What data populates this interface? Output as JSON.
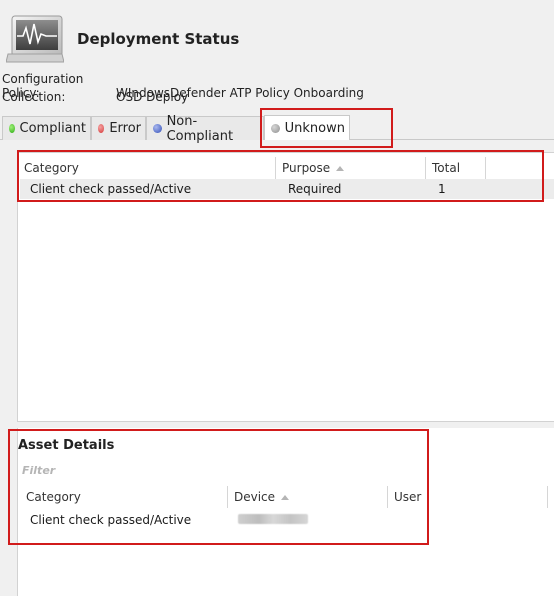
{
  "header": {
    "title": "Deployment Status",
    "icon": "monitor-pulse-icon"
  },
  "meta": {
    "policy_label": "Configuration Policy:",
    "policy_value": "WIndowsDefender ATP Policy Onboarding",
    "collection_label": "Collection:",
    "collection_value": "OSD Deploy"
  },
  "tabs": [
    {
      "label": "Compliant",
      "color": "#2fae14"
    },
    {
      "label": "Error",
      "color": "#d63a3a"
    },
    {
      "label": "Non-Compliant",
      "color": "#3450b8"
    },
    {
      "label": "Unknown",
      "color": "#8f8f8f",
      "active": true
    }
  ],
  "summary_grid": {
    "columns": [
      "Category",
      "Purpose",
      "Total"
    ],
    "rows": [
      {
        "category": "Client check passed/Active",
        "purpose": "Required",
        "total": "1"
      }
    ]
  },
  "asset_details": {
    "title": "Asset Details",
    "filter_placeholder": "Filter",
    "columns": [
      "Category",
      "Device",
      "User"
    ],
    "rows": [
      {
        "category": "Client check passed/Active"
      }
    ]
  },
  "colors": {
    "highlight": "#d11b1b",
    "selected_row": "#ececec"
  }
}
